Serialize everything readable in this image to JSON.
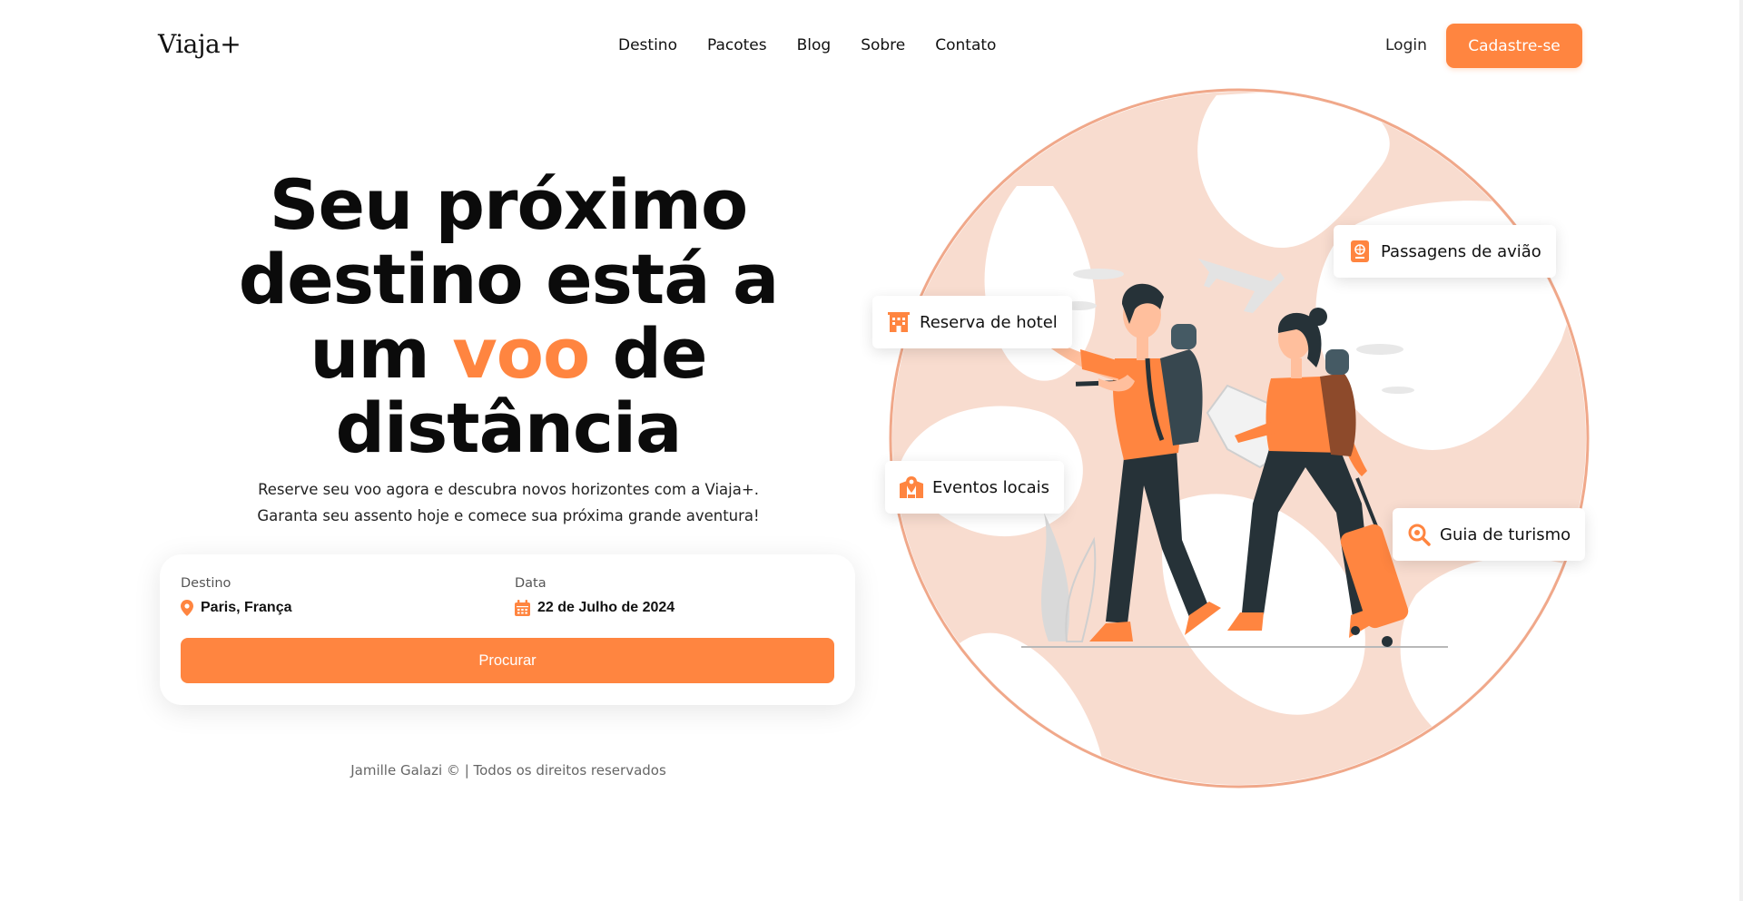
{
  "header": {
    "logo": "Viaja+",
    "nav": [
      "Destino",
      "Pacotes",
      "Blog",
      "Sobre",
      "Contato"
    ],
    "login_label": "Login",
    "signup_label": "Cadastre-se"
  },
  "hero": {
    "title_before": "Seu próximo destino está a um ",
    "title_accent": "voo",
    "title_after": " de distância",
    "subtitle_line1": "Reserve seu voo agora e descubra novos horizontes com a Viaja+.",
    "subtitle_line2": "Garanta seu assento hoje e comece sua próxima grande aventura!"
  },
  "search": {
    "destination_label": "Destino",
    "destination_value": "Paris, França",
    "destination_icon": "location-pin-icon",
    "date_label": "Data",
    "date_value": "22 de Julho de 2024",
    "date_icon": "calendar-icon",
    "button_label": "Procurar"
  },
  "badges": {
    "hotel": "Reserva de hotel",
    "flights": "Passagens de avião",
    "events": "Eventos locais",
    "tourism": "Guia de turismo"
  },
  "footer": {
    "text": "Jamille Galazi © | Todos os direitos reservados"
  },
  "colors": {
    "accent": "#ff8540",
    "globe": "#f8dccf",
    "dark": "#263238"
  }
}
